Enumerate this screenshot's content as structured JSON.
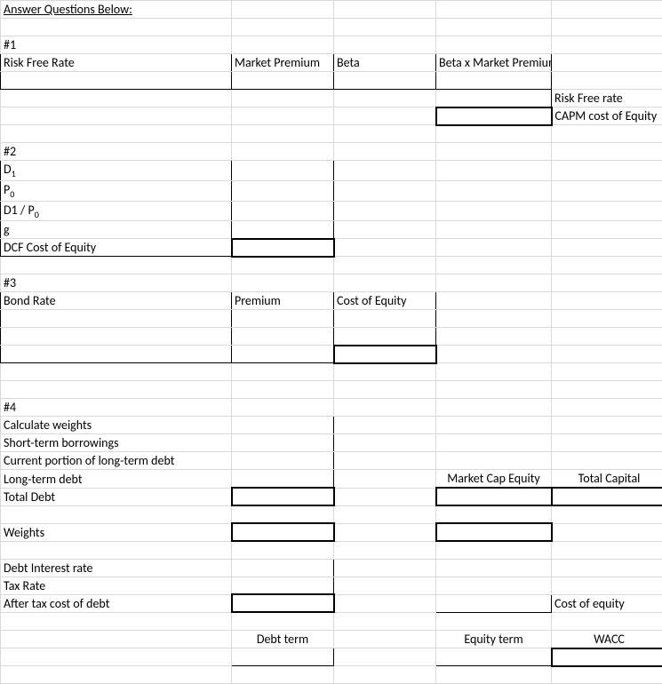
{
  "title": "Answer Questions Below:",
  "q1": {
    "num": "#1",
    "risk_free_rate": "Risk Free Rate",
    "market_premium": "Market Premium",
    "beta": "Beta",
    "beta_x_mp": "Beta x Market Premium",
    "rfr_label": "Risk Free rate",
    "capm_label": "CAPM cost of Equity"
  },
  "q2": {
    "num": "#2",
    "d1": "D",
    "d1_sub": "1",
    "p0": "P",
    "p0_sub": "0",
    "d1p0": "D1 / P",
    "d1p0_sub": "0",
    "g": "g",
    "dcf": "DCF Cost of Equity"
  },
  "q3": {
    "num": "#3",
    "bond_rate": "Bond Rate",
    "premium": "Premium",
    "cost_equity": "Cost of Equity"
  },
  "q4": {
    "num": "#4",
    "calc_weights": "Calculate weights",
    "stb": "Short-term borrowings",
    "cpltd": "Current portion of long-term debt",
    "ltd": "Long-term debt",
    "total_debt": "Total Debt",
    "mce": "Market Cap Equity",
    "total_capital": "Total Capital",
    "weights": "Weights",
    "dir": "Debt Interest rate",
    "tax": "Tax Rate",
    "atcd": "After tax cost of debt",
    "coe": "Cost of equity",
    "debt_term": "Debt term",
    "equity_term": "Equity term",
    "wacc": "WACC"
  }
}
